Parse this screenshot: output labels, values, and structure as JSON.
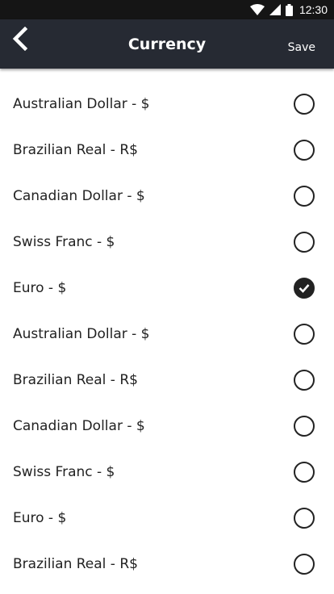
{
  "status_bar": {
    "time": "12:30",
    "icons": [
      "wifi-icon",
      "signal-icon",
      "battery-icon"
    ]
  },
  "app_bar": {
    "title": "Currency",
    "save_label": "Save",
    "back_icon": "back-chevron-icon"
  },
  "currencies": [
    {
      "label": "Australian Dollar - $",
      "selected": false
    },
    {
      "label": "Brazilian Real - R$",
      "selected": false
    },
    {
      "label": "Canadian Dollar - $",
      "selected": false
    },
    {
      "label": "Swiss Franc - $",
      "selected": false
    },
    {
      "label": "Euro - $",
      "selected": true
    },
    {
      "label": "Australian Dollar - $",
      "selected": false
    },
    {
      "label": "Brazilian Real - R$",
      "selected": false
    },
    {
      "label": "Canadian Dollar - $",
      "selected": false
    },
    {
      "label": "Swiss Franc - $",
      "selected": false
    },
    {
      "label": "Euro - $",
      "selected": false
    },
    {
      "label": "Brazilian Real - R$",
      "selected": false
    }
  ],
  "colors": {
    "app_bar_bg": "#262a33",
    "status_bar_bg": "#151515",
    "text": "#222222",
    "radio_checked": "#222222"
  }
}
